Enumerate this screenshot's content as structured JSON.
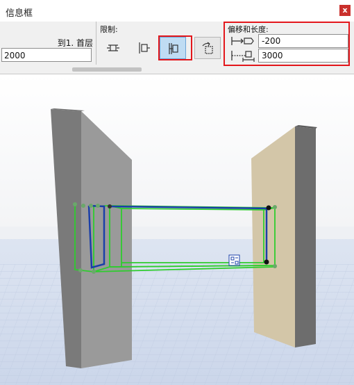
{
  "window": {
    "title": "信息框",
    "close_label": "x"
  },
  "story": {
    "label": "到1. 首层",
    "elevation_value": "2000"
  },
  "constraints": {
    "label": "限制:",
    "buttons": [
      {
        "icon": "constraint-free-icon",
        "selected": false
      },
      {
        "icon": "constraint-fix-start-icon",
        "selected": false
      },
      {
        "icon": "constraint-fix-center-icon",
        "selected": true
      },
      {
        "icon": "constraint-rotate-icon",
        "selected": false
      }
    ]
  },
  "offset_length": {
    "label": "偏移和长度:",
    "offset_value": "-200",
    "length_value": "3000",
    "offset_icon": "offset-arrow-icon",
    "length_icon": "length-arrow-icon"
  },
  "colors": {
    "highlight_red": "#e3161b",
    "selection_blue": "#bfdcf3",
    "wall_left": "#8c8c8c",
    "wall_right": "#d3c6a8",
    "selection_green": "#2ecc2e",
    "axis_blue": "#1a3fa8"
  }
}
